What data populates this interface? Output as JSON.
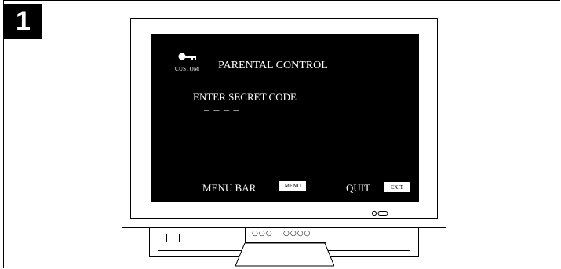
{
  "step": {
    "number": "1"
  },
  "screen": {
    "custom_label": "CUSTOM",
    "title": "PARENTAL CONTROL",
    "prompt": "ENTER SECRET CODE",
    "code_placeholder": "–  –  –  –",
    "menu_bar_label": "MENU BAR",
    "menu_button": "MENU",
    "quit_label": "QUIT",
    "exit_button": "EXIT",
    "icon": "key-icon"
  },
  "tv": {
    "controls_left": "○○○",
    "controls_right": "○○○○"
  }
}
